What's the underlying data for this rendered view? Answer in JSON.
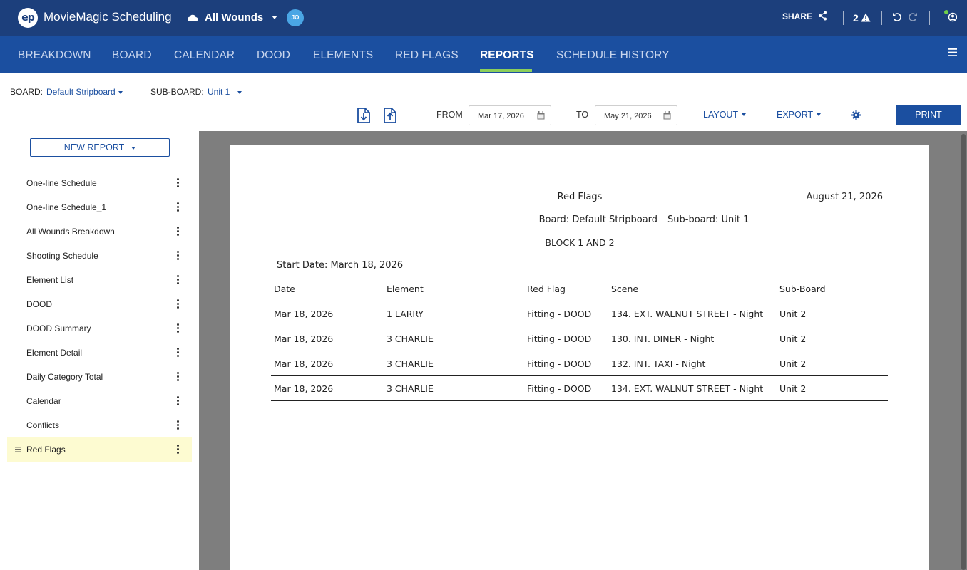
{
  "header": {
    "logo_text": "ep",
    "app_name": "MovieMagic Scheduling",
    "project_name": "All Wounds",
    "user_initials": "JO",
    "share_label": "SHARE",
    "warning_count": "2"
  },
  "nav": {
    "tabs": [
      {
        "label": "BREAKDOWN"
      },
      {
        "label": "BOARD"
      },
      {
        "label": "CALENDAR"
      },
      {
        "label": "DOOD"
      },
      {
        "label": "ELEMENTS"
      },
      {
        "label": "RED FLAGS"
      },
      {
        "label": "REPORTS",
        "active": true
      },
      {
        "label": "SCHEDULE HISTORY"
      }
    ]
  },
  "board_bar": {
    "board_label": "BOARD:",
    "board_value": "Default Stripboard",
    "subboard_label": "SUB-BOARD:",
    "subboard_value": "Unit 1"
  },
  "toolbar": {
    "from_label": "FROM",
    "from_date": "Mar 17, 2026",
    "to_label": "TO",
    "to_date": "May 21, 2026",
    "layout_label": "LAYOUT",
    "export_label": "EXPORT",
    "print_label": "PRINT"
  },
  "sidebar": {
    "new_report_label": "NEW REPORT",
    "reports": [
      {
        "label": "One-line Schedule"
      },
      {
        "label": "One-line Schedule_1"
      },
      {
        "label": "All Wounds Breakdown"
      },
      {
        "label": "Shooting Schedule"
      },
      {
        "label": "Element List"
      },
      {
        "label": "DOOD"
      },
      {
        "label": "DOOD Summary"
      },
      {
        "label": "Element Detail"
      },
      {
        "label": "Daily Category Total"
      },
      {
        "label": "Calendar"
      },
      {
        "label": "Conflicts"
      },
      {
        "label": "Red Flags",
        "selected": true
      }
    ]
  },
  "report": {
    "title": "Red Flags",
    "date": "August 21, 2026",
    "board_line": "Board: Default Stripboard",
    "subboard_line": "Sub-board: Unit 1",
    "block": "BLOCK 1 AND 2",
    "start_date": "Start Date: March 18, 2026",
    "columns": [
      "Date",
      "Element",
      "Red Flag",
      "Scene",
      "Sub-Board"
    ],
    "rows": [
      [
        "Mar 18, 2026",
        "1 LARRY",
        "Fitting - DOOD",
        "134. EXT. WALNUT STREET - Night",
        "Unit 2"
      ],
      [
        "Mar 18, 2026",
        "3 CHARLIE",
        "Fitting - DOOD",
        "130. INT. DINER - Night",
        "Unit 2"
      ],
      [
        "Mar 18, 2026",
        "3 CHARLIE",
        "Fitting - DOOD",
        "132. INT. TAXI - Night",
        "Unit 2"
      ],
      [
        "Mar 18, 2026",
        "3 CHARLIE",
        "Fitting - DOOD",
        "134. EXT. WALNUT STREET - Night",
        "Unit 2"
      ]
    ]
  },
  "colors": {
    "header_bg": "#1c3f7c",
    "nav_bg": "#1b4fa0",
    "active_underline": "#8ccf5a",
    "selected_row": "#fdfbd1",
    "preview_bg": "#7e7e7e"
  }
}
